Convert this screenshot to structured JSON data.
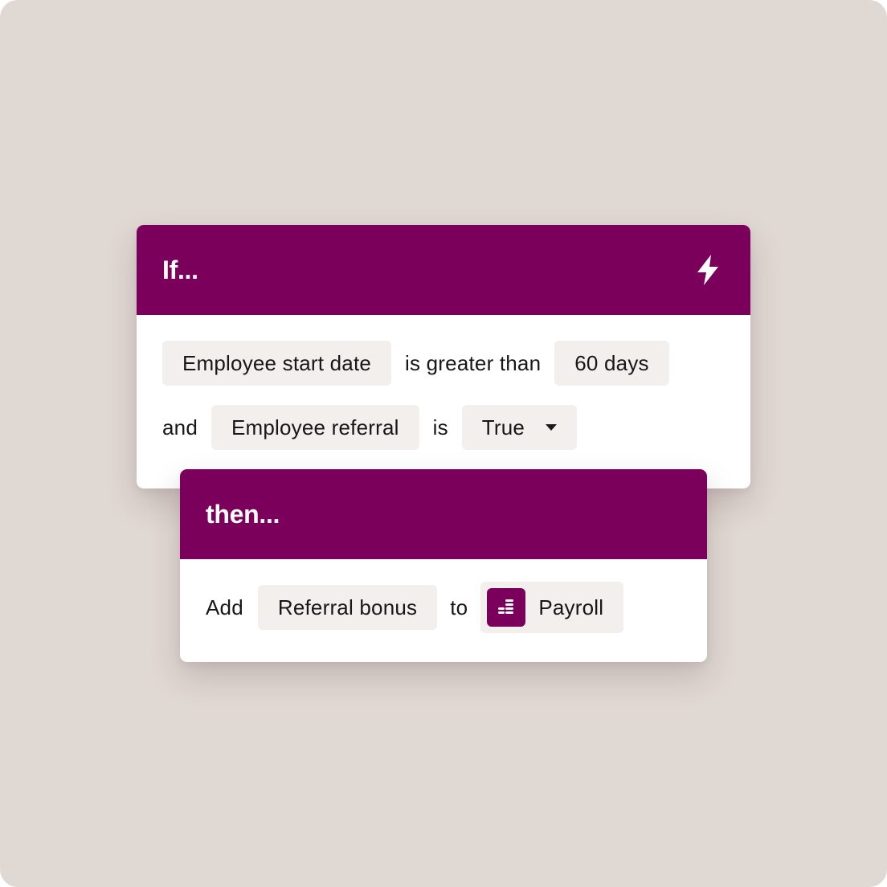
{
  "colors": {
    "background": "#e0d8d3",
    "header": "#7a005b",
    "chip": "#f2efed",
    "text": "#171717"
  },
  "if_card": {
    "title": "If...",
    "trigger_icon": "lightning-bolt-icon",
    "row1": {
      "field": "Employee start date",
      "operator": "is greater than",
      "value": "60 days"
    },
    "row2": {
      "connector": "and",
      "field": "Employee referral",
      "operator": "is",
      "value": "True"
    }
  },
  "then_card": {
    "title": "then...",
    "action": "Add",
    "item": "Referral bonus",
    "preposition": "to",
    "target": "Payroll",
    "target_icon": "coin-stack-icon"
  }
}
